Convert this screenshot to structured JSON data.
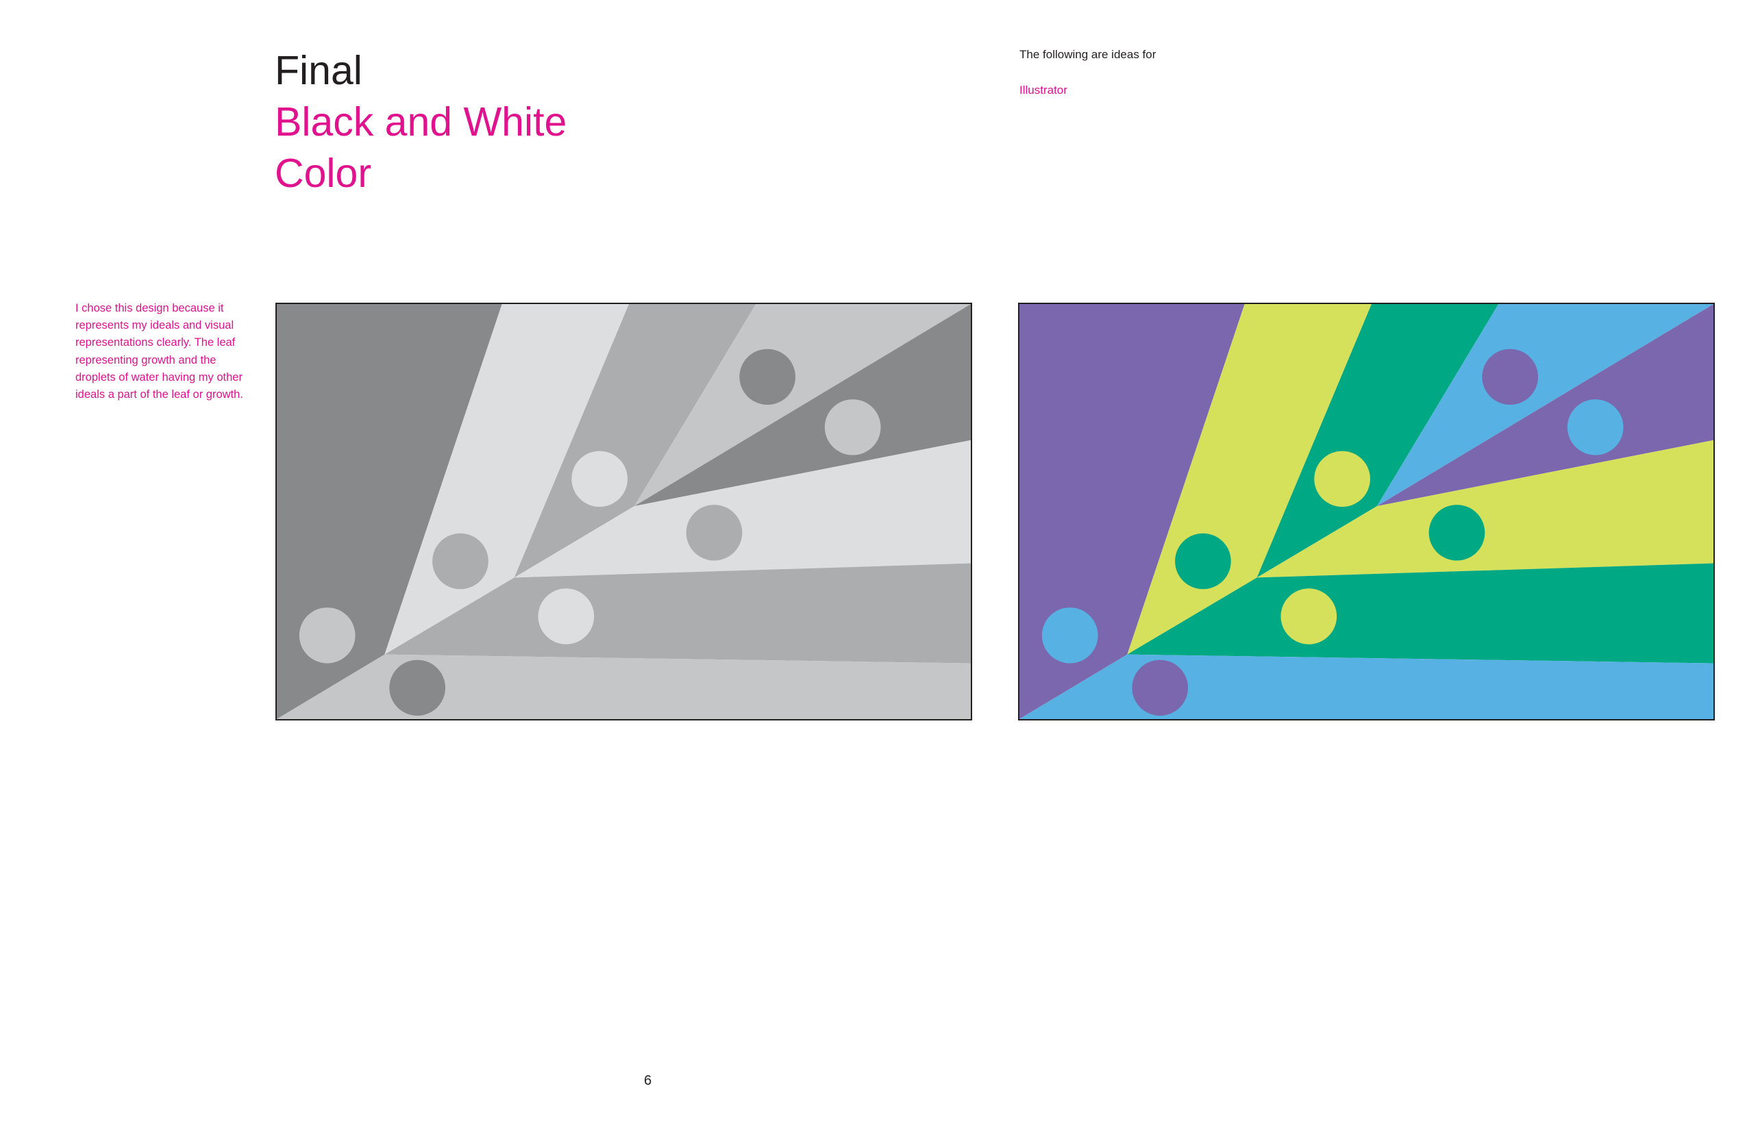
{
  "heading": {
    "final": "Final",
    "black_and_white": "Black and White",
    "color": "Color"
  },
  "intro": {
    "line": "The following are ideas for",
    "tool": "Illustrator"
  },
  "caption": "I chose this design because it represents my ideals and visual representations clearly. The leaf representing growth and the droplets of water having my other ideals a part of the leaf or growth.",
  "page_number": "6",
  "palettes": {
    "black_and_white": {
      "A": "#88898b",
      "B": "#dddedf",
      "C": "#acadae",
      "D": "#c5c6c7",
      "border": "#231f20"
    },
    "color": {
      "A": "#7a67ae",
      "B": "#d5e05b",
      "C": "#00a884",
      "D": "#58b1e3",
      "border": "#231f20"
    }
  },
  "accent_color": "#e0128d",
  "text_color": "#231f20"
}
